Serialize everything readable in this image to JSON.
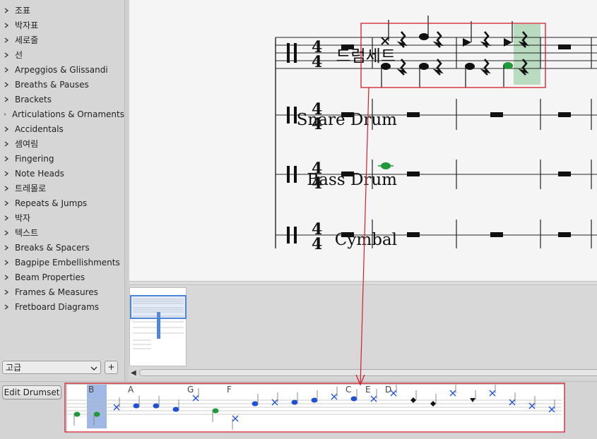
{
  "palette": {
    "items": [
      {
        "label": "조표"
      },
      {
        "label": "박자표"
      },
      {
        "label": "세로줄"
      },
      {
        "label": "선"
      },
      {
        "label": "Arpeggios & Glissandi"
      },
      {
        "label": "Breaths & Pauses"
      },
      {
        "label": "Brackets"
      },
      {
        "label": "Articulations & Ornaments"
      },
      {
        "label": "Accidentals"
      },
      {
        "label": "셈여림"
      },
      {
        "label": "Fingering"
      },
      {
        "label": "Note Heads"
      },
      {
        "label": "트레몰로"
      },
      {
        "label": "Repeats & Jumps"
      },
      {
        "label": "박자"
      },
      {
        "label": "텍스트"
      },
      {
        "label": "Breaks & Spacers"
      },
      {
        "label": "Bagpipe Embellishments"
      },
      {
        "label": "Beam Properties"
      },
      {
        "label": "Frames & Measures"
      },
      {
        "label": "Fretboard Diagrams"
      }
    ],
    "mode": "고급",
    "add_label": "+"
  },
  "score": {
    "instruments": [
      "드럼세트",
      "Snare Drum",
      "Bass Drum",
      "Cymbal"
    ],
    "time_signature": {
      "top": "4",
      "bottom": "4"
    }
  },
  "drumset": {
    "edit_label": "Edit Drumset",
    "shortcuts": [
      "",
      "B",
      "",
      "A",
      "",
      "",
      "G",
      "",
      "F",
      "",
      "",
      "",
      "",
      "",
      "C",
      "E",
      "D",
      "",
      "",
      "",
      "",
      "",
      "",
      "",
      ""
    ],
    "selected_index": 1
  },
  "colors": {
    "note_blue": "#1f4fd6",
    "note_green": "#1e9a3a",
    "selection_red": "#d0202c",
    "highlight_green": "#b9dcc0",
    "strip_selected": "#9fb8e6"
  }
}
